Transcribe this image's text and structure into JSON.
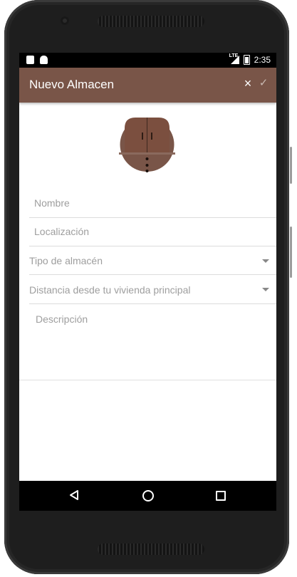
{
  "statusbar": {
    "network_label": "LTE",
    "time": "2:35",
    "icons": [
      "notification-icon",
      "android-icon",
      "signal-icon",
      "battery-charging-icon"
    ]
  },
  "appbar": {
    "title": "Nuevo Almacen",
    "close_icon": "×",
    "confirm_icon": "✓",
    "color": "#795548"
  },
  "form": {
    "nombre_placeholder": "Nombre",
    "localizacion_placeholder": "Localización",
    "tipo_label": "Tipo de almacén",
    "distancia_label": "Distancia desde tu vivienda principal",
    "descripcion_placeholder": "Descripción"
  },
  "navbar": {
    "icons": [
      "back-icon",
      "home-icon",
      "recent-apps-icon"
    ]
  }
}
